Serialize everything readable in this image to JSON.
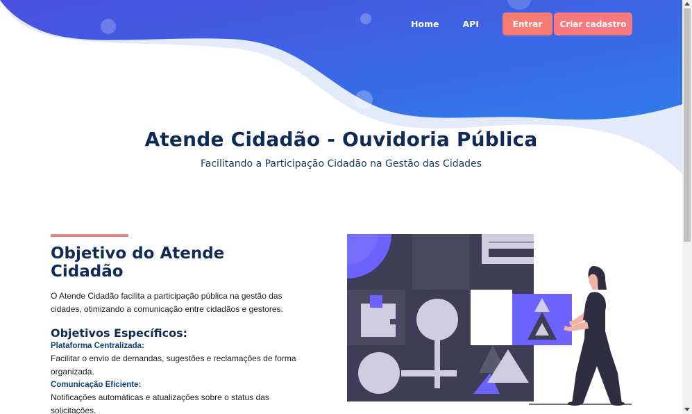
{
  "nav": {
    "home": "Home",
    "api": "API",
    "login": "Entrar",
    "signup": "Criar cadastro"
  },
  "hero": {
    "title": "Atende Cidadão - Ouvidoria Pública",
    "subtitle": "Facilitando a Participação Cidadão na Gestão das Cidades"
  },
  "objective": {
    "title": "Objetivo do Atende Cidadão",
    "text": "O Atende Cidadão facilita a participação pública na gestão das cidades, otimizando a comunicação entre cidadãos e gestores.",
    "specific_title": "Objetivos Específicos:",
    "items": [
      {
        "title": "Plataforma Centralizada:",
        "text": "Facilitar o envio de demandas, sugestões e reclamações de forma organizada."
      },
      {
        "title": "Comunicação Eficiente:",
        "text": "Notificações automáticas e atualizações sobre o status das solicitações."
      }
    ]
  },
  "colors": {
    "hero_start": "#4a4fe0",
    "hero_end": "#2f7bea",
    "heading": "#0e2a55",
    "button": "#f77d72",
    "accent_bar": "#ec8282",
    "illustration_purple": "#6c63ff",
    "illustration_dark": "#3f3d56"
  },
  "icons": [
    "scroll-up-arrow-icon",
    "scroll-down-arrow-icon"
  ]
}
